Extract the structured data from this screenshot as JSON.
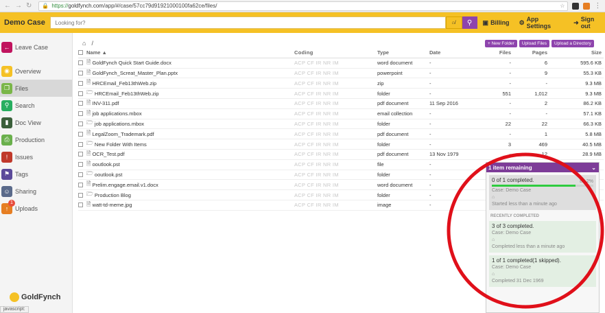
{
  "browser": {
    "url_secure": "https://",
    "url_domain": "goldfynch.com",
    "url_path": "/app/#/case/57cc79d91921000100fa62ce/files/",
    "status_text": "javascript:"
  },
  "topbar": {
    "case_title": "Demo Case",
    "search_placeholder": "Looking for?",
    "search_tag": "/",
    "billing_label": "Billing",
    "settings_label": "App Settings",
    "signout_label": "Sign out"
  },
  "sidebar": {
    "items": [
      {
        "label": "Leave Case",
        "icon": "sign-out-icon",
        "color": "#c0145e"
      },
      {
        "label": "Overview",
        "icon": "eye-icon",
        "color": "#f5c125"
      },
      {
        "label": "Files",
        "icon": "files-icon",
        "color": "#7ab648"
      },
      {
        "label": "Search",
        "icon": "search-icon",
        "color": "#27ae60"
      },
      {
        "label": "Doc View",
        "icon": "bookmark-icon",
        "color": "#3a5f3a"
      },
      {
        "label": "Production",
        "icon": "print-icon",
        "color": "#6ab04c"
      },
      {
        "label": "Issues",
        "icon": "alert-icon",
        "color": "#c0392b"
      },
      {
        "label": "Tags",
        "icon": "tag-icon",
        "color": "#5b4a9a"
      },
      {
        "label": "Sharing",
        "icon": "users-icon",
        "color": "#5a6a8a"
      },
      {
        "label": "Uploads",
        "icon": "upload-icon",
        "color": "#e67e22",
        "badge": "1"
      }
    ],
    "logo_text": "GoldFynch"
  },
  "main": {
    "breadcrumb_sep": "/",
    "actions": {
      "new_folder": "+ New Folder",
      "upload_files": "Upload Files",
      "upload_directory": "Upload a Directory"
    },
    "columns": {
      "name": "Name",
      "coding": "Coding",
      "type": "Type",
      "date": "Date",
      "files": "Files",
      "pages": "Pages",
      "size": "Size"
    },
    "rows": [
      {
        "icon": "file-word-icon",
        "name": "GoldFynch Quick Start Guide.docx",
        "coding": "ACP CF IR NR IM",
        "type": "word document",
        "date": "-",
        "files": "-",
        "pages": "6",
        "size": "595.6 KB"
      },
      {
        "icon": "file-ppt-icon",
        "name": "GoldFynch_Screat_Master_Plan.pptx",
        "coding": "ACP CF IR NR IM",
        "type": "powerpoint",
        "date": "-",
        "files": "-",
        "pages": "9",
        "size": "55.3 KB"
      },
      {
        "icon": "file-zip-icon",
        "name": "HRCEmail_Feb13thWeb.zip",
        "coding": "ACP CF IR NR IM",
        "type": "zip",
        "date": "-",
        "files": "-",
        "pages": "-",
        "size": "9.3 MB"
      },
      {
        "icon": "folder-icon",
        "name": "HRCEmail_Feb13thWeb.zip",
        "coding": "ACP CF IR NR IM",
        "type": "folder",
        "date": "-",
        "files": "551",
        "pages": "1,012",
        "size": "9.3 MB"
      },
      {
        "icon": "file-pdf-icon",
        "name": "INV-311.pdf",
        "coding": "ACP CF IR NR IM",
        "type": "pdf document",
        "date": "11 Sep 2016",
        "files": "-",
        "pages": "2",
        "size": "86.2 KB"
      },
      {
        "icon": "file-mail-icon",
        "name": "job applications.mbox",
        "coding": "ACP CF IR NR IM",
        "type": "email collection",
        "date": "-",
        "files": "-",
        "pages": "-",
        "size": "57.1 KB"
      },
      {
        "icon": "folder-icon",
        "name": "job applications.mbox",
        "coding": "ACP CF IR NR IM",
        "type": "folder",
        "date": "-",
        "files": "22",
        "pages": "22",
        "size": "66.3 KB"
      },
      {
        "icon": "file-pdf-icon",
        "name": "LegalZoom_Trademark.pdf",
        "coding": "ACP CF IR NR IM",
        "type": "pdf document",
        "date": "-",
        "files": "-",
        "pages": "1",
        "size": "5.8 MB"
      },
      {
        "icon": "folder-icon",
        "name": "New Folder With Items",
        "coding": "ACP CF IR NR IM",
        "type": "folder",
        "date": "-",
        "files": "3",
        "pages": "469",
        "size": "40.5 MB"
      },
      {
        "icon": "file-pdf-icon",
        "name": "OCR_Test.pdf",
        "coding": "ACP CF IR NR IM",
        "type": "pdf document",
        "date": "13 Nov 1979",
        "files": "-",
        "pages": "12",
        "size": "28.9 MB"
      },
      {
        "icon": "file-icon",
        "name": "ooutlook.pst",
        "coding": "ACP CF IR NR IM",
        "type": "file",
        "date": "-",
        "files": "",
        "pages": "",
        "size": ""
      },
      {
        "icon": "folder-icon",
        "name": "ooutlook.pst",
        "coding": "ACP CF IR NR IM",
        "type": "folder",
        "date": "-",
        "files": "",
        "pages": "",
        "size": ""
      },
      {
        "icon": "file-word-icon",
        "name": "Prelim.engage.email.v1.docx",
        "coding": "ACP CF IR NR IM",
        "type": "word document",
        "date": "-",
        "files": "",
        "pages": "",
        "size": ""
      },
      {
        "icon": "folder-icon",
        "name": "Production Blog",
        "coding": "ACP CF IR NR IM",
        "type": "folder",
        "date": "-",
        "files": "",
        "pages": "",
        "size": ""
      },
      {
        "icon": "file-image-icon",
        "name": "watt-td-meme.jpg",
        "coding": "ACP CF IR NR IM",
        "type": "image",
        "date": "-",
        "files": "",
        "pages": "",
        "size": ""
      }
    ]
  },
  "panel": {
    "header": "1 item remaining",
    "active_job": {
      "title": "0 of 1 completed.",
      "case": "Case: Demo Case",
      "percent": "82.2%",
      "progress": 0.822,
      "time": "Started less than a minute ago"
    },
    "recent_label": "RECENTLY COMPLETED",
    "recent_jobs": [
      {
        "title": "3 of 3 completed.",
        "case": "Case: Demo Case",
        "time": "Completed less than a minute ago"
      },
      {
        "title": "1 of 1 completed(1 skipped).",
        "case": "Case: Demo Case",
        "time": "Completed 31 Dec 1969"
      }
    ]
  },
  "colors": {
    "brand_yellow": "#f5c125",
    "accent_purple": "#8e44ad",
    "annotation_red": "#e0101a"
  }
}
